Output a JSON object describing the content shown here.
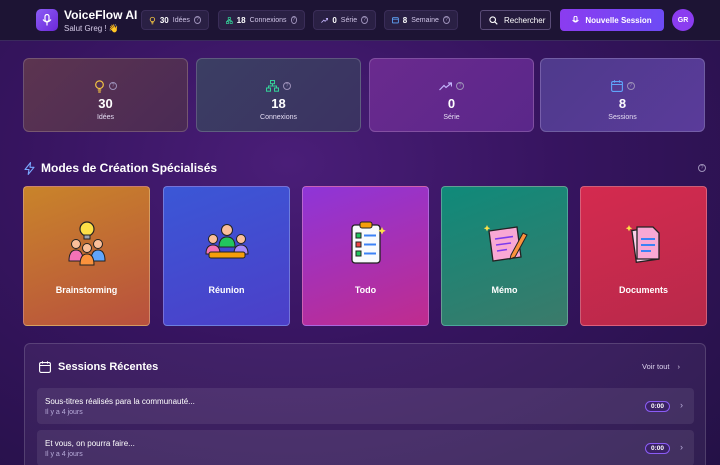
{
  "header": {
    "app_title": "VoiceFlow AI",
    "greeting": "Salut Greg ! 👋",
    "stats": [
      {
        "icon": "lightbulb-icon",
        "value": "30",
        "label": "Idées",
        "color": "#f5c542"
      },
      {
        "icon": "network-icon",
        "value": "18",
        "label": "Connexions",
        "color": "#34d399"
      },
      {
        "icon": "trending-up-icon",
        "value": "0",
        "label": "Série",
        "color": "#c4b5fd"
      },
      {
        "icon": "calendar-icon",
        "value": "8",
        "label": "Semaine",
        "color": "#60a5fa"
      }
    ],
    "search_label": "Rechercher",
    "new_session_label": "Nouvelle Session",
    "avatar_initials": "GR"
  },
  "stat_cards": [
    {
      "icon": "lightbulb-icon",
      "value": "30",
      "label": "Idées",
      "color": "#f5c542"
    },
    {
      "icon": "network-icon",
      "value": "18",
      "label": "Connexions",
      "color": "#34d399"
    },
    {
      "icon": "trending-up-icon",
      "value": "0",
      "label": "Série",
      "color": "#c4b5fd"
    },
    {
      "icon": "calendar-icon",
      "value": "8",
      "label": "Sessions",
      "color": "#60a5fa"
    }
  ],
  "modes": {
    "title": "Modes de Création Spécialisés",
    "items": [
      {
        "label": "Brainstorming",
        "icon": "brainstorming-illustration"
      },
      {
        "label": "Réunion",
        "icon": "meeting-illustration"
      },
      {
        "label": "Todo",
        "icon": "checklist-illustration"
      },
      {
        "label": "Mémo",
        "icon": "memo-pencil-illustration"
      },
      {
        "label": "Documents",
        "icon": "documents-illustration"
      }
    ]
  },
  "recent": {
    "title": "Sessions Récentes",
    "see_all": "Voir tout",
    "sessions": [
      {
        "title": "Sous-titres réalisés para la communauté...",
        "time": "Il y a 4 jours",
        "duration": "0:00"
      },
      {
        "title": "Et vous, on pourra faire...",
        "time": "Il y a 4 jours",
        "duration": "0:00"
      }
    ]
  }
}
